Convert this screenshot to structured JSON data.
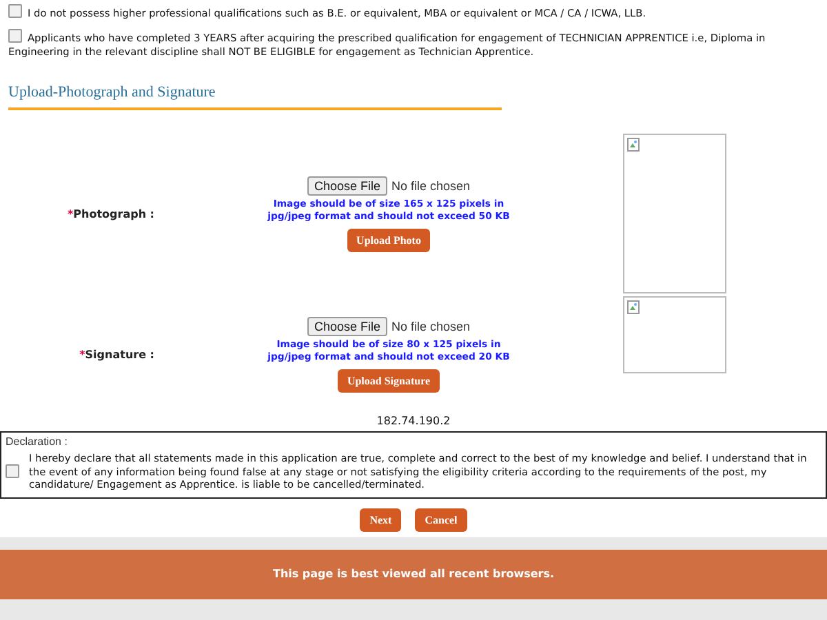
{
  "eligibility": [
    {
      "text": "I do not possess higher professional qualifications such as B.E. or equivalent, MBA or equivalent or MCA / CA / ICWA, LLB.",
      "checked": false
    },
    {
      "text": "Applicants who have completed 3 YEARS after acquiring the prescribed qualification for engagement of TECHNICIAN APPRENTICE i.e, Diploma in Engineering in the relevant discipline shall NOT BE ELIGIBLE for engagement as Technician Apprentice.",
      "checked": false
    }
  ],
  "section_title": "Upload-Photograph and Signature",
  "uploads": [
    {
      "kind": "photo",
      "required_mark": "*",
      "label": "Photograph :",
      "choose_button": "Choose File",
      "file_status": "No file chosen",
      "hint": "Image should be of size 165 x 125 pixels in jpg/jpeg format and should not exceed 50 KB",
      "upload_button": "Upload Photo"
    },
    {
      "kind": "signature",
      "required_mark": "*",
      "label": "Signature :",
      "choose_button": "Choose File",
      "file_status": "No file chosen",
      "hint": "Image should be of size 80 x 125 pixels in jpg/jpeg format and should not exceed 20 KB",
      "upload_button": "Upload Signature"
    }
  ],
  "ip_address": "182.74.190.2",
  "declaration": {
    "title": "Declaration :",
    "text": "I hereby declare that all statements made in this application are true, complete and correct to the best of my knowledge and belief. I understand that in the event of any information being found false at any stage or not satisfying the eligibility criteria according to the requirements of the post, my candidature/ Engagement as Apprentice. is liable to be cancelled/terminated.",
    "checked": false
  },
  "buttons": [
    "Next",
    "Cancel"
  ],
  "footer": "This page is best viewed all recent browsers."
}
